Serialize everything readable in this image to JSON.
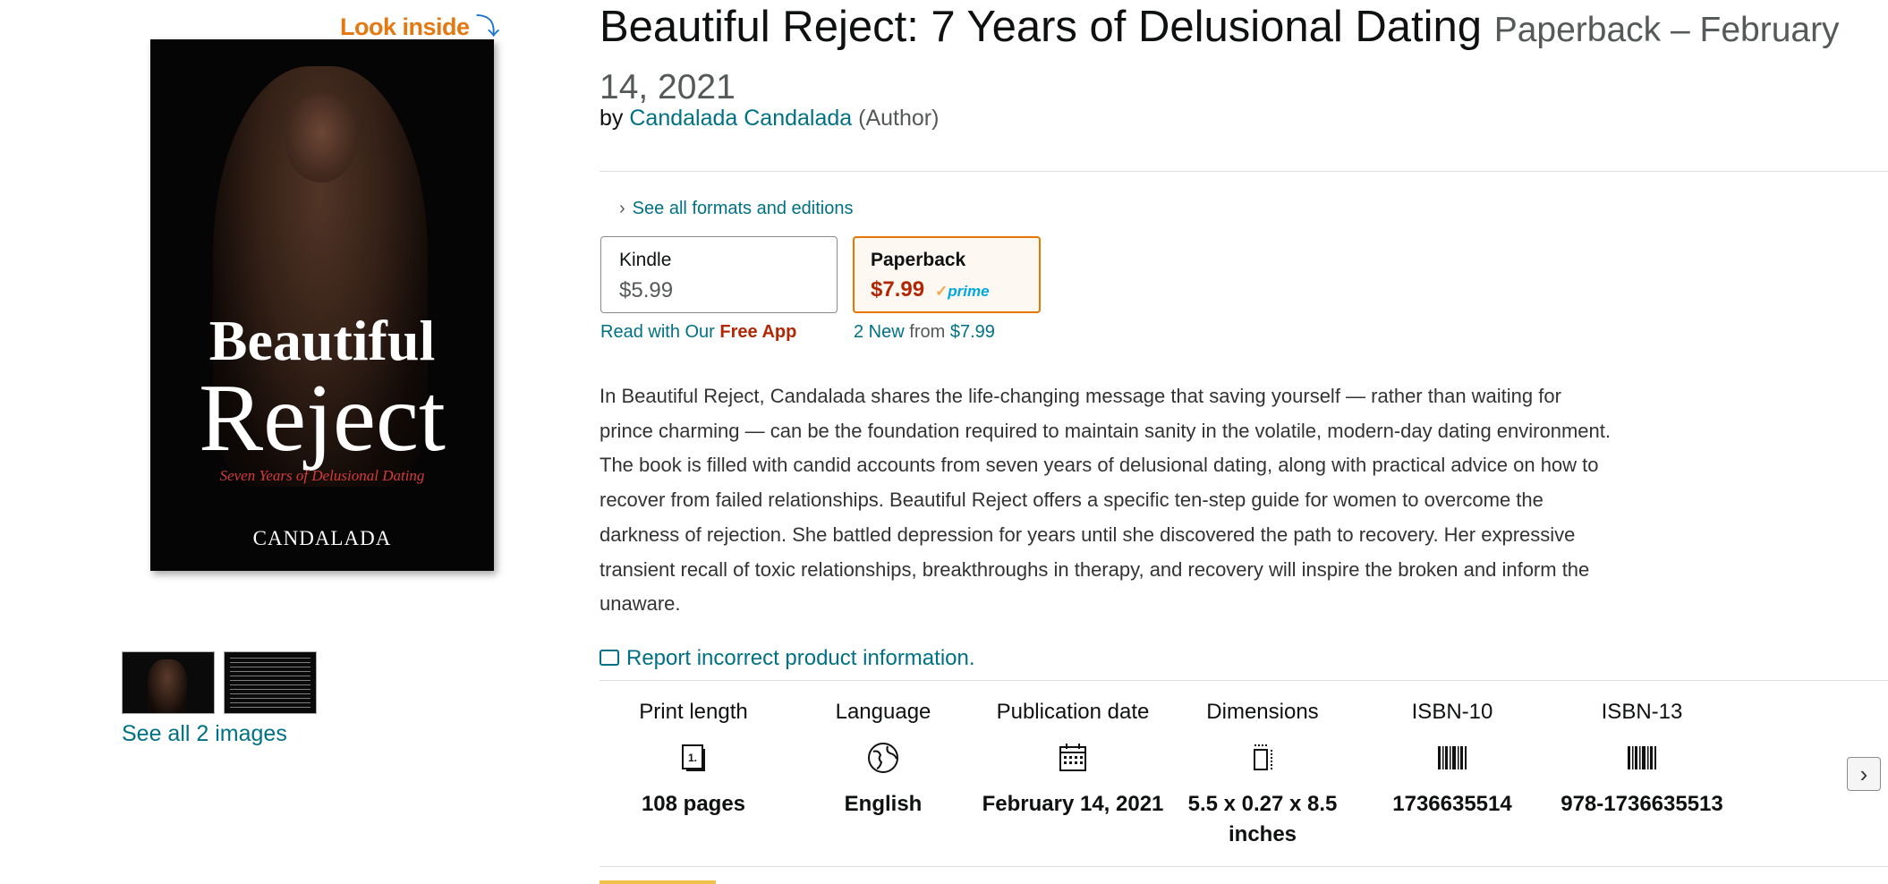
{
  "look_inside": {
    "label": "Look inside",
    "arrow": "⤵"
  },
  "cover": {
    "title_line1": "Beautiful",
    "title_line2": "Reject",
    "subtitle": "Seven Years of Delusional Dating",
    "author": "CANDALADA"
  },
  "gallery": {
    "see_all": "See all 2 images"
  },
  "product": {
    "title": "Beautiful Reject: 7 Years of Delusional Dating",
    "format_date": "Paperback – February 14, 2021",
    "by": "by",
    "author": "Candalada Candalada",
    "role": "(Author)"
  },
  "formats": {
    "see_all_link": "See all formats and editions",
    "chevron": "›",
    "options": [
      {
        "name": "Kindle",
        "price": "$5.99"
      },
      {
        "name": "Paperback",
        "price": "$7.99",
        "prime": "prime",
        "prime_check": "✓",
        "selected": true
      }
    ],
    "read_with_prefix": "Read with Our",
    "read_with_free": "Free App",
    "new_count": "2 New",
    "new_from": "from",
    "new_price": "$7.99"
  },
  "description": "In Beautiful Reject, Candalada shares the life-changing message that saving yourself — rather than waiting for prince charming — can be the foundation required to maintain sanity in the volatile, modern-day dating environment. The book is filled with candid accounts from seven years of delusional dating, along with practical advice on how to recover from failed relationships. Beautiful Reject offers a specific ten-step guide for women to overcome the darkness of rejection. She battled depression for years until she discovered the path to recovery. Her expressive transient recall of toxic relationships, breakthroughs in therapy, and recovery will inspire the broken and inform the unaware.",
  "report_link": "Report incorrect product information.",
  "details": [
    {
      "label": "Print length",
      "value": "108 pages",
      "icon": "book-pages-icon"
    },
    {
      "label": "Language",
      "value": "English",
      "icon": "globe-icon"
    },
    {
      "label": "Publication date",
      "value": "February 14, 2021",
      "icon": "calendar-icon"
    },
    {
      "label": "Dimensions",
      "value": "5.5 x 0.27 x 8.5 inches",
      "icon": "dimensions-icon"
    },
    {
      "label": "ISBN-10",
      "value": "1736635514",
      "icon": "barcode-icon"
    },
    {
      "label": "ISBN-13",
      "value": "978-1736635513",
      "icon": "barcode-icon"
    }
  ],
  "next_arrow": "›",
  "colors": {
    "link": "#007185",
    "price": "#B12704",
    "selected_border": "#E77600",
    "look_inside": "#E47911"
  }
}
